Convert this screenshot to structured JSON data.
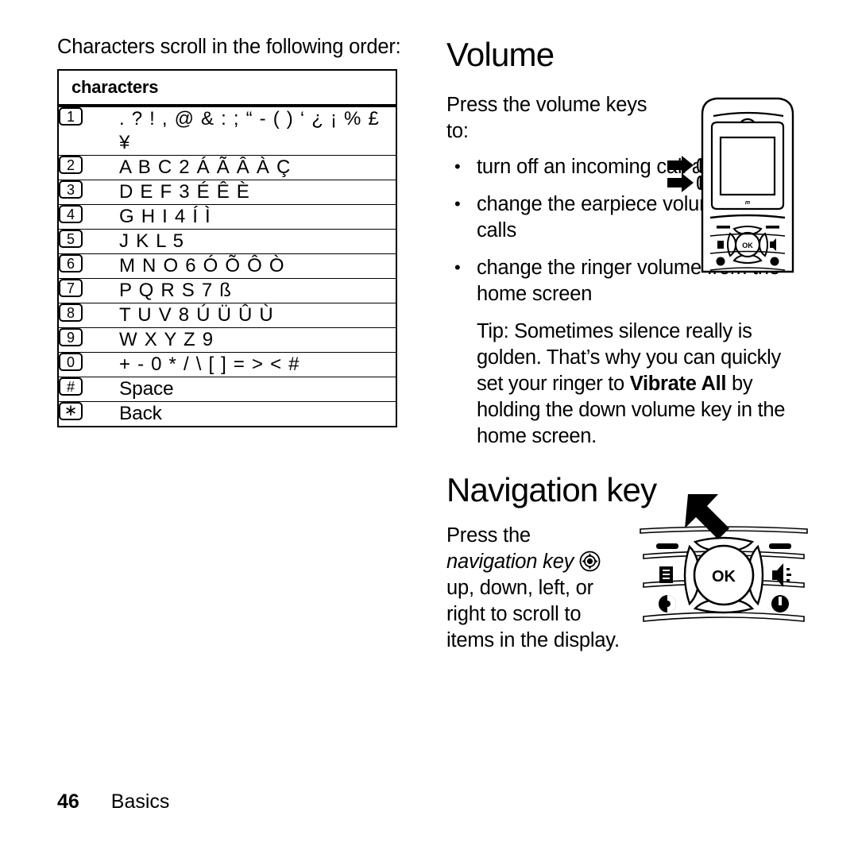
{
  "left": {
    "intro_line": "Characters scroll in the following order:",
    "table": {
      "header": "characters",
      "rows": [
        {
          "key": "1",
          "chars": ". ? ! , @ & : ; “ - ( ) ‘ ¿ ¡ % £ ¥"
        },
        {
          "key": "2",
          "chars": "A B C 2 Á Ã Â À Ç"
        },
        {
          "key": "3",
          "chars": "D E F 3 É Ê È"
        },
        {
          "key": "4",
          "chars": "G H I 4 Í Ì"
        },
        {
          "key": "5",
          "chars": "J K L 5"
        },
        {
          "key": "6",
          "chars": "M N O 6 Ó Õ Ô Ò"
        },
        {
          "key": "7",
          "chars": "P Q R S 7 ß"
        },
        {
          "key": "8",
          "chars": "T U V 8 Ú Ü Û Ù"
        },
        {
          "key": "9",
          "chars": "W X Y Z 9"
        },
        {
          "key": "0",
          "chars": "+ - 0 * / \\ [ ] = > < #"
        },
        {
          "key": "#",
          "chars": "Space"
        },
        {
          "key": "∗",
          "chars": "Back"
        }
      ]
    }
  },
  "footer": {
    "page_number": "46",
    "chapter": "Basics"
  },
  "volume": {
    "title": "Volume",
    "intro": "Press the volume keys to:",
    "bullets": [
      "turn off an incoming call alert",
      "change the earpiece volume during calls",
      "change the ringer volume from the home screen"
    ],
    "tip": {
      "part1": "Tip: Sometimes silence really is golden. That’s why you can quickly set your ringer to ",
      "bold1": "Vibrate All",
      "part2": " by holding the down volume key in the home screen."
    }
  },
  "navigation": {
    "title": "Navigation key",
    "line1": "Press the",
    "italic_label": "navigation key",
    "line2": "up, down, left, or right to scroll to items in the display."
  },
  "figures": {
    "phone": {
      "ok_label": "OK",
      "brand_mark": "M"
    },
    "navkey": {
      "ok_label": "OK"
    }
  },
  "colors": {
    "ink": "#000000",
    "paper": "#ffffff",
    "line_gray": "#555555"
  }
}
